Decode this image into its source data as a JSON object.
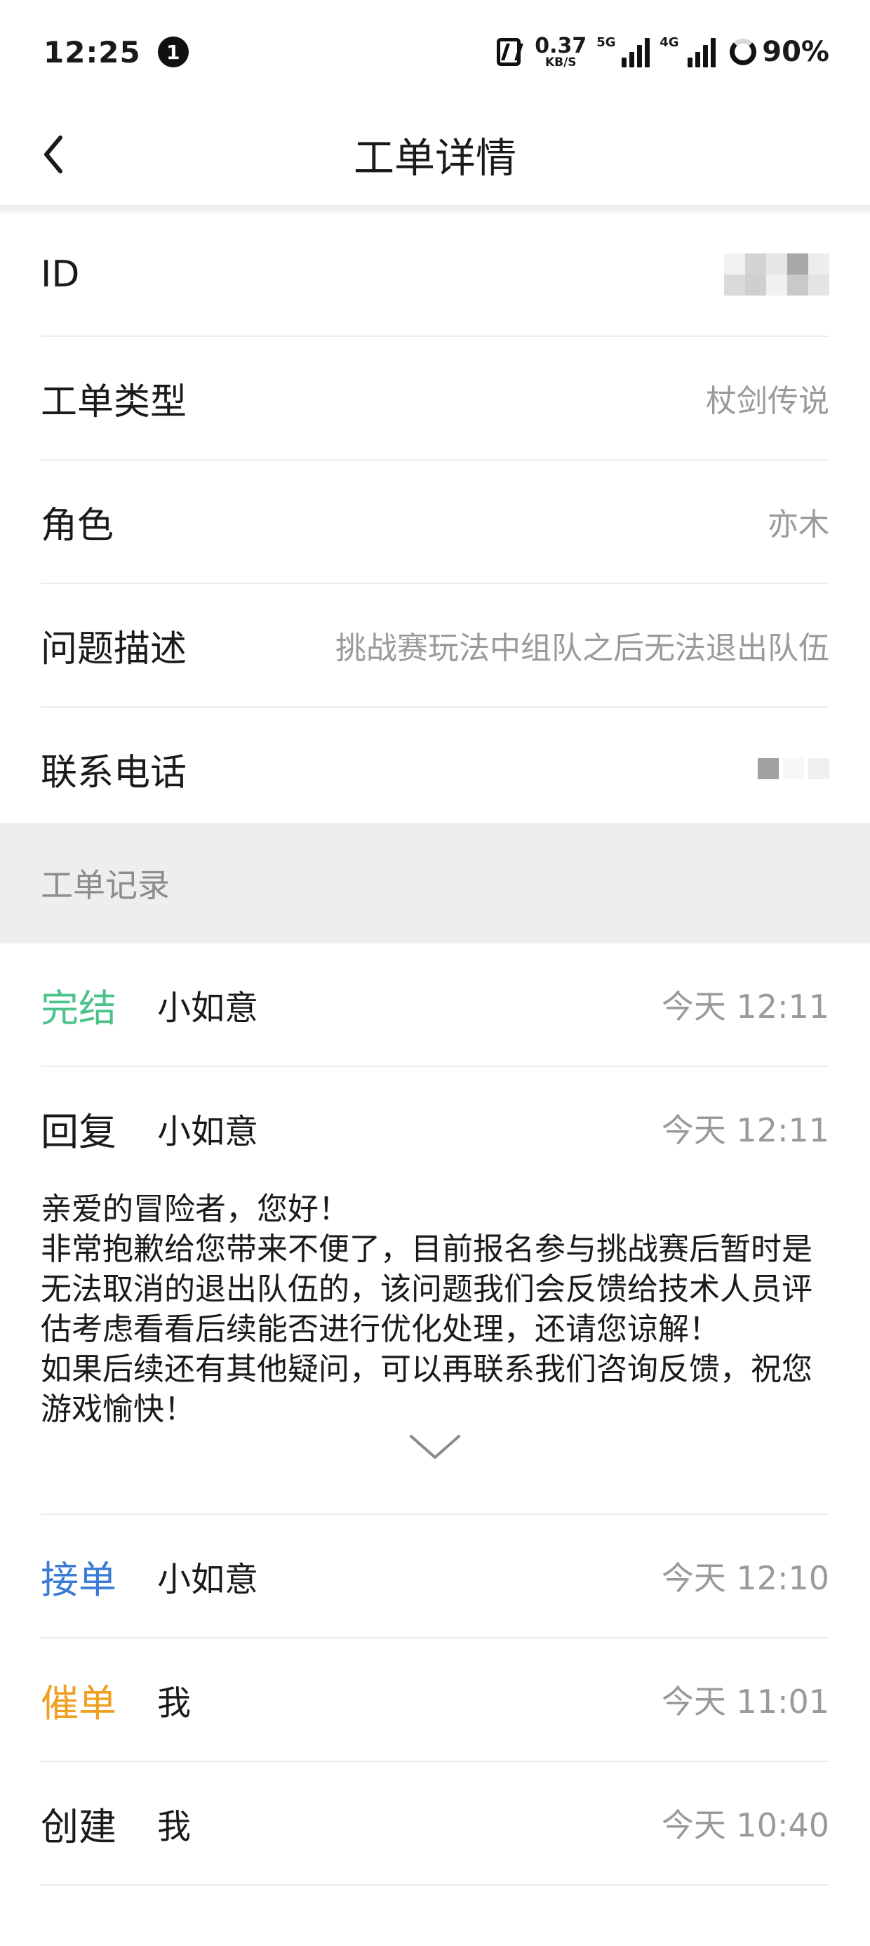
{
  "status_bar": {
    "time": "12:25",
    "notification_count": "1",
    "net_speed_value": "0.37",
    "net_speed_unit": "KB/S",
    "signal1_tag": "5G",
    "signal2_tag": "4G",
    "battery": "90%"
  },
  "nav": {
    "title": "工单详情",
    "back_icon": "chevron-left-icon"
  },
  "info": {
    "id_label": "ID",
    "type_label": "工单类型",
    "type_value": "杖剑传说",
    "role_label": "角色",
    "role_value": "亦木",
    "desc_label": "问题描述",
    "desc_value": "挑战赛玩法中组队之后无法退出队伍",
    "phone_label": "联系电话"
  },
  "records": {
    "section_title": "工单记录",
    "items": [
      {
        "type": "完结",
        "user": "小如意",
        "time": "今天 12:11",
        "color": "#4cc38a"
      },
      {
        "type": "回复",
        "user": "小如意",
        "time": "今天 12:11",
        "color": "#1a1a1a"
      },
      {
        "type": "接单",
        "user": "小如意",
        "time": "今天 12:10",
        "color": "#3a7bd5"
      },
      {
        "type": "催单",
        "user": "我",
        "time": "今天 11:01",
        "color": "#f0a020"
      },
      {
        "type": "创建",
        "user": "我",
        "time": "今天 10:40",
        "color": "#1a1a1a"
      }
    ],
    "reply_lines": [
      "亲爱的冒险者，您好！",
      "非常抱歉给您带来不便了，目前报名参与挑战赛后暂时是无法取消的退出队伍的，该问题我们会反馈给技术人员评估考虑看看后续能否进行优化处理，还请您谅解！",
      "如果后续还有其他疑问，可以再联系我们咨询反馈，祝您游戏愉快！"
    ],
    "expand_icon": "chevron-down-icon"
  }
}
